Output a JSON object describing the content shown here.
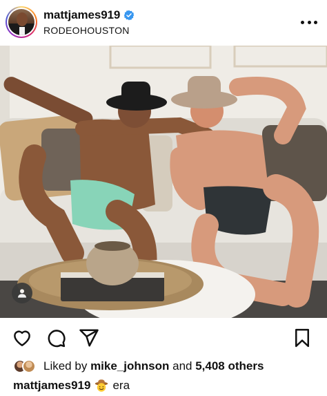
{
  "header": {
    "username": "mattjames919",
    "verified": true,
    "location": "RODEOHOUSTON",
    "more_icon": "more-horizontal-icon"
  },
  "post": {
    "media_type": "photo",
    "tag_icon": "user-tag-icon"
  },
  "actions": {
    "icons": [
      "heart-icon",
      "comment-icon",
      "share-icon",
      "bookmark-icon"
    ]
  },
  "likes": {
    "prefix": "Liked by",
    "liked_by_user": "mike_johnson",
    "connector": "and",
    "others": "5,408 others"
  },
  "caption": {
    "username": "mattjames919",
    "emoji": "cowboy-hat-face",
    "text": "era"
  },
  "colors": {
    "text": "#111111",
    "verified_blue": "#3897f0",
    "background": "#ffffff"
  }
}
